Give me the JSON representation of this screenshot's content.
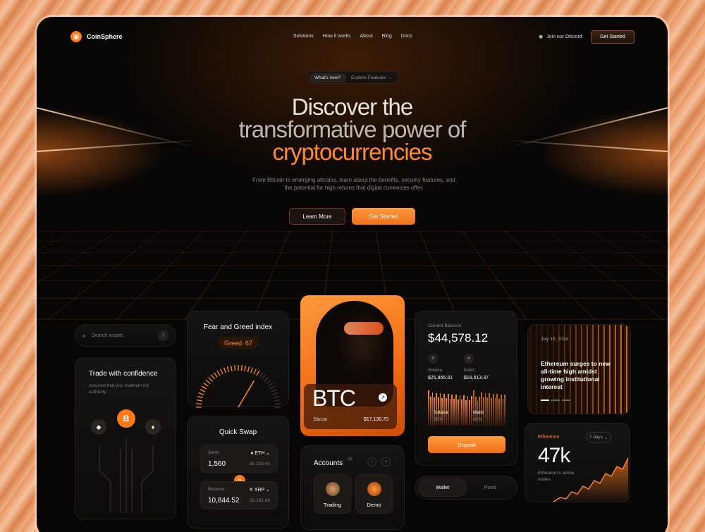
{
  "brand": {
    "name": "CoinSphere",
    "accent": "#ff7a1a"
  },
  "nav": {
    "links": [
      "Solutions",
      "How it works",
      "About",
      "Blog",
      "Docs"
    ],
    "discord": "Join our Discord",
    "cta": "Get Started"
  },
  "hero": {
    "pill_new": "What's new?",
    "pill_link": "Explore Features →",
    "line1": "Discover the",
    "line2": "transformative power of",
    "line3": "cryptocurrencies",
    "subtitle": "From Bitcoin to emerging altcoins, learn about the benefits, security features, and the potential for high returns that digital currencies offer.",
    "learn": "Learn More",
    "start": "Get Started"
  },
  "search": {
    "placeholder": "Search assets",
    "shortcut": "/"
  },
  "trade": {
    "title": "Trade with confidence",
    "subtitle": "Assured that you maintain full authority"
  },
  "fear": {
    "title": "Fear and Greed index",
    "badge": "Greed: 67",
    "value": 67
  },
  "swap": {
    "title": "Quick Swap",
    "send_label": "Send",
    "send_token": "ETH",
    "send_amount": "1,560",
    "send_usd": "$5,233.45",
    "receive_label": "Receive",
    "receive_token": "XRP",
    "receive_amount": "10,844.52",
    "receive_usd": "$5,161.88"
  },
  "btc": {
    "symbol": "BTC",
    "name": "Bitcoin",
    "price": "$17,130.70"
  },
  "accounts": {
    "title": "Accounts",
    "count": "(2)",
    "items": [
      "Trading",
      "Demo"
    ]
  },
  "balance": {
    "label": "Current Balance",
    "value": "$44,578.12",
    "coins": [
      {
        "name": "Solana",
        "value": "$25,855.31",
        "pct": "58%"
      },
      {
        "name": "Matic",
        "value": "$19,613.37",
        "pct": "42%"
      }
    ],
    "deposit": "Deposit"
  },
  "tabs": [
    "Wallet",
    "Pools"
  ],
  "news": {
    "date": "July 15, 2024",
    "headline": "Ethereum surges to new all-time high amidst growing institutional interest"
  },
  "eth": {
    "name": "Ethereum",
    "range": "7 days",
    "value": "47k",
    "desc": "Ethereum's active nodes"
  }
}
